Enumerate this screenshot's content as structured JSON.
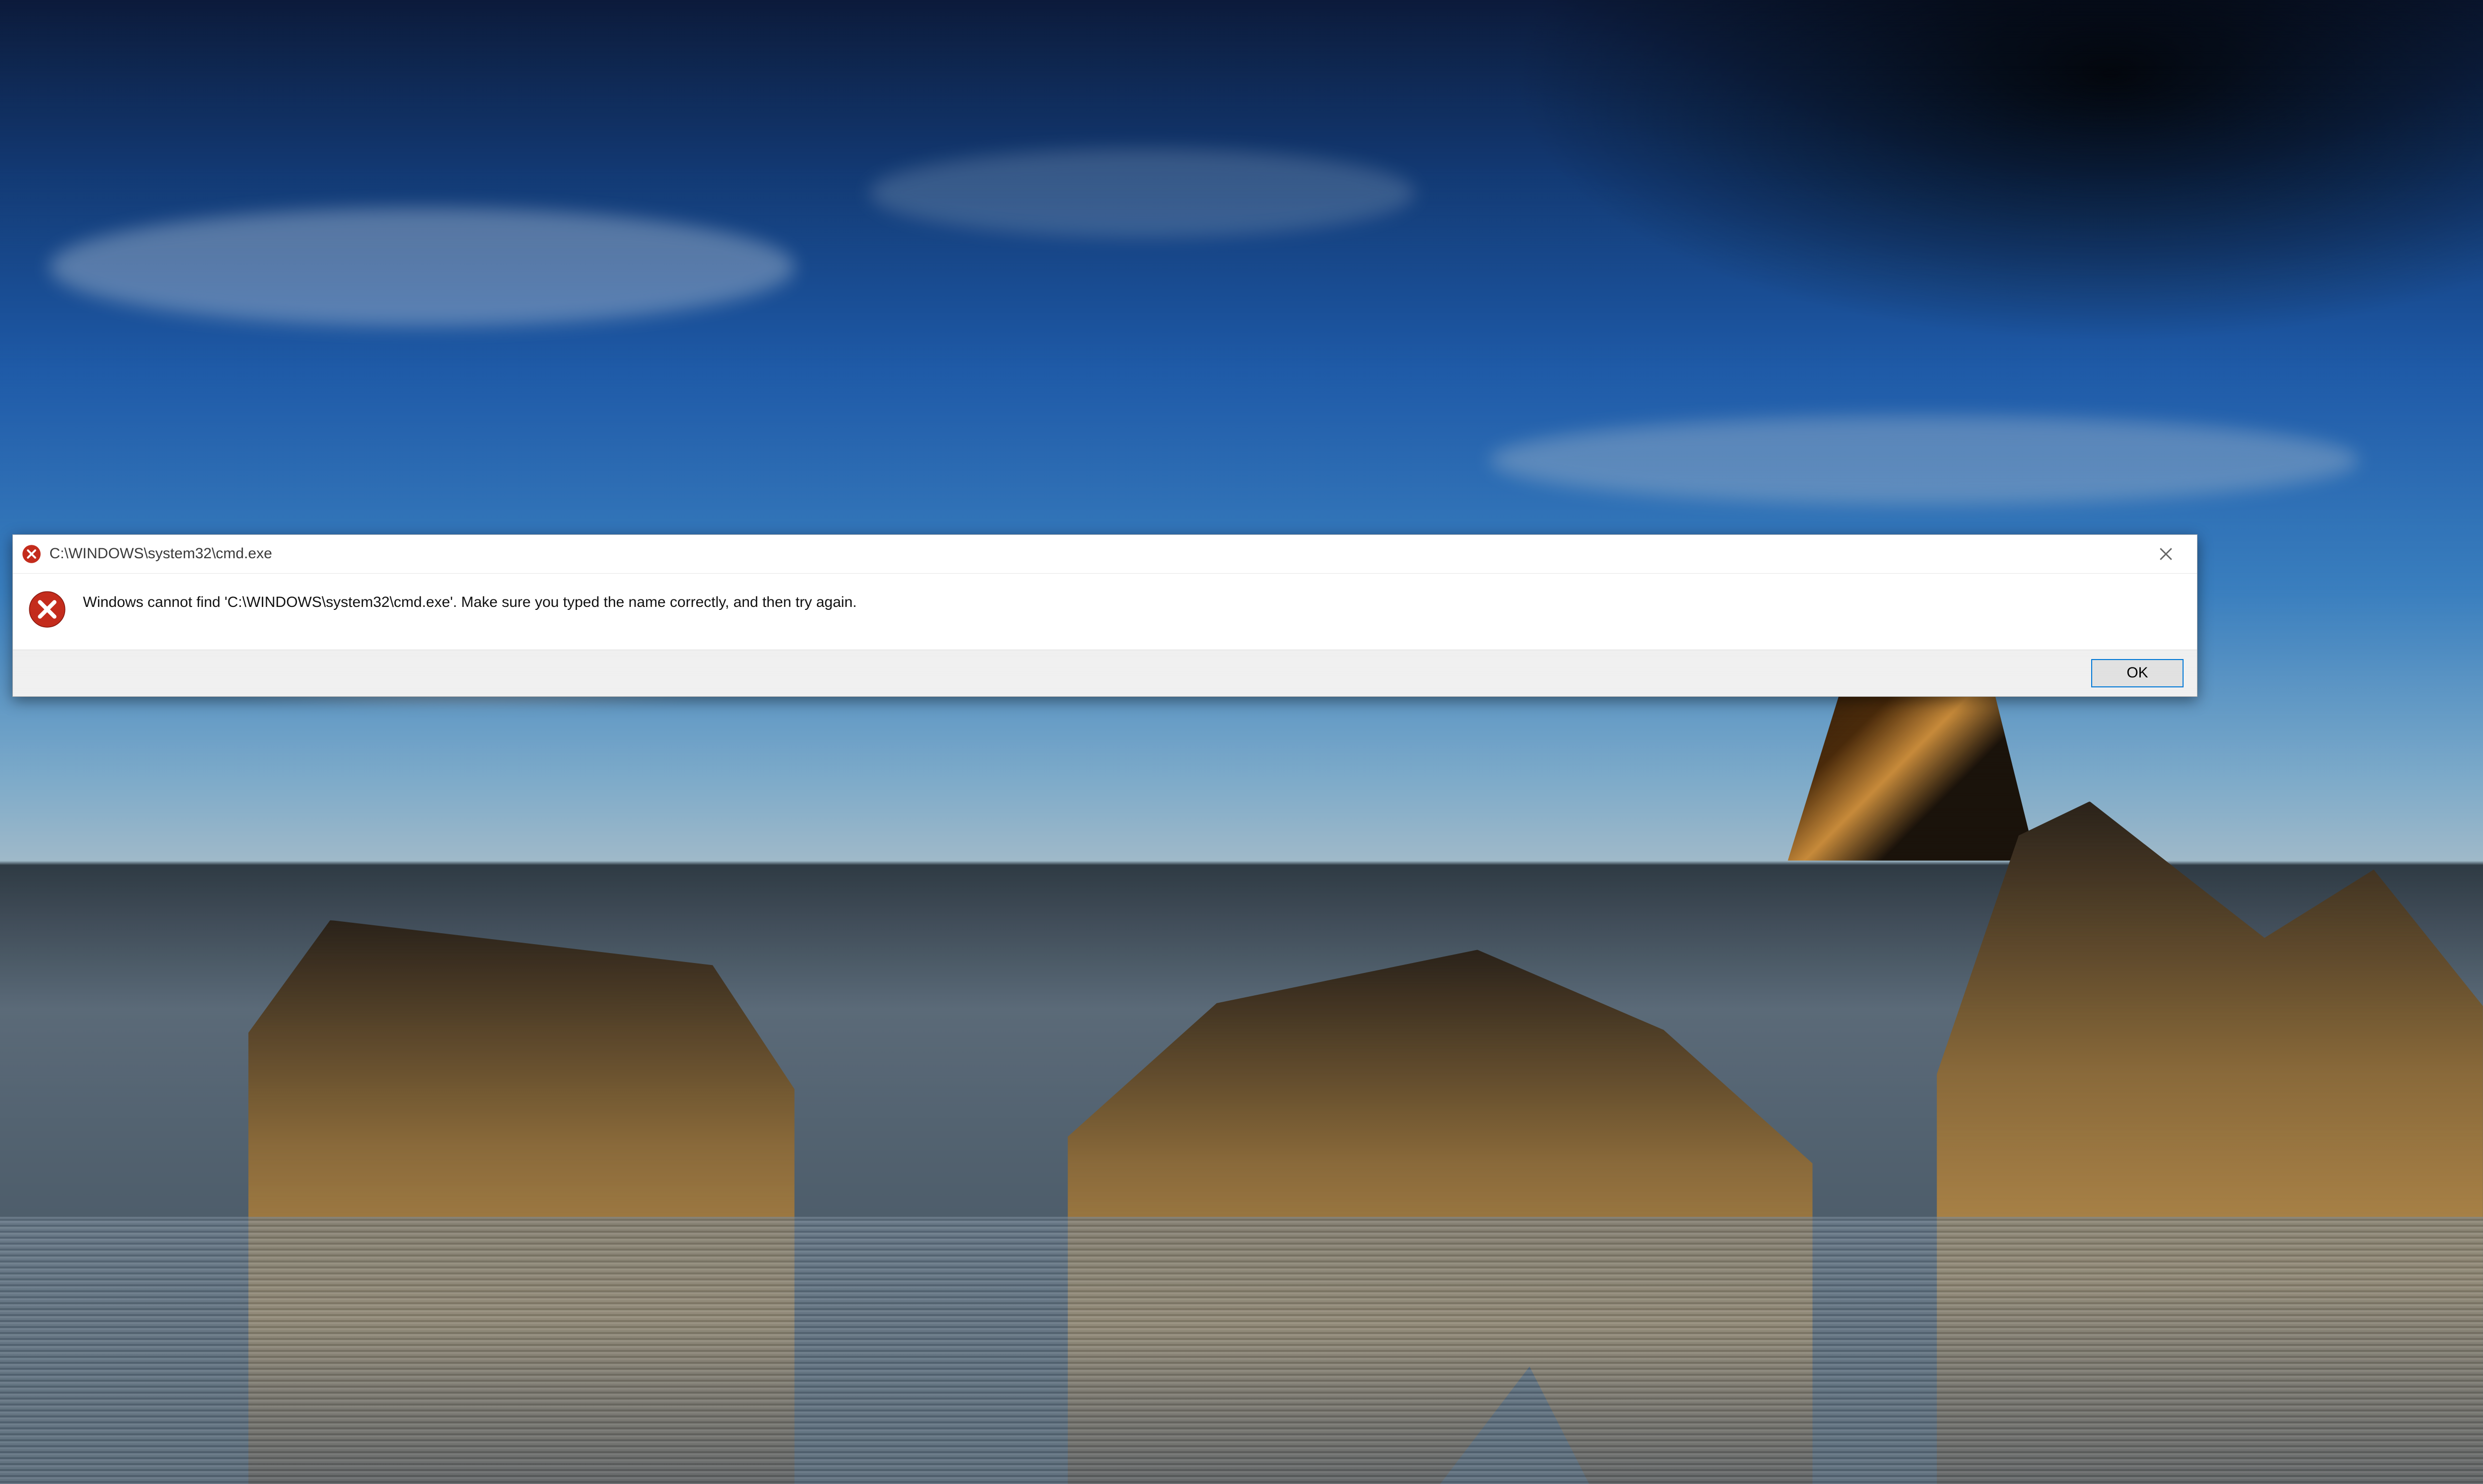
{
  "dialog": {
    "title": "C:\\WINDOWS\\system32\\cmd.exe",
    "message": "Windows cannot find 'C:\\WINDOWS\\system32\\cmd.exe'. Make sure you typed the name correctly, and then try again.",
    "ok_label": "OK",
    "icon_name": "error-icon",
    "title_icon_name": "error-icon"
  },
  "colors": {
    "error_red": "#c42b1c",
    "accent_blue": "#0078d7",
    "button_face": "#e1e1e1",
    "button_row_bg": "#f0f0f0"
  }
}
